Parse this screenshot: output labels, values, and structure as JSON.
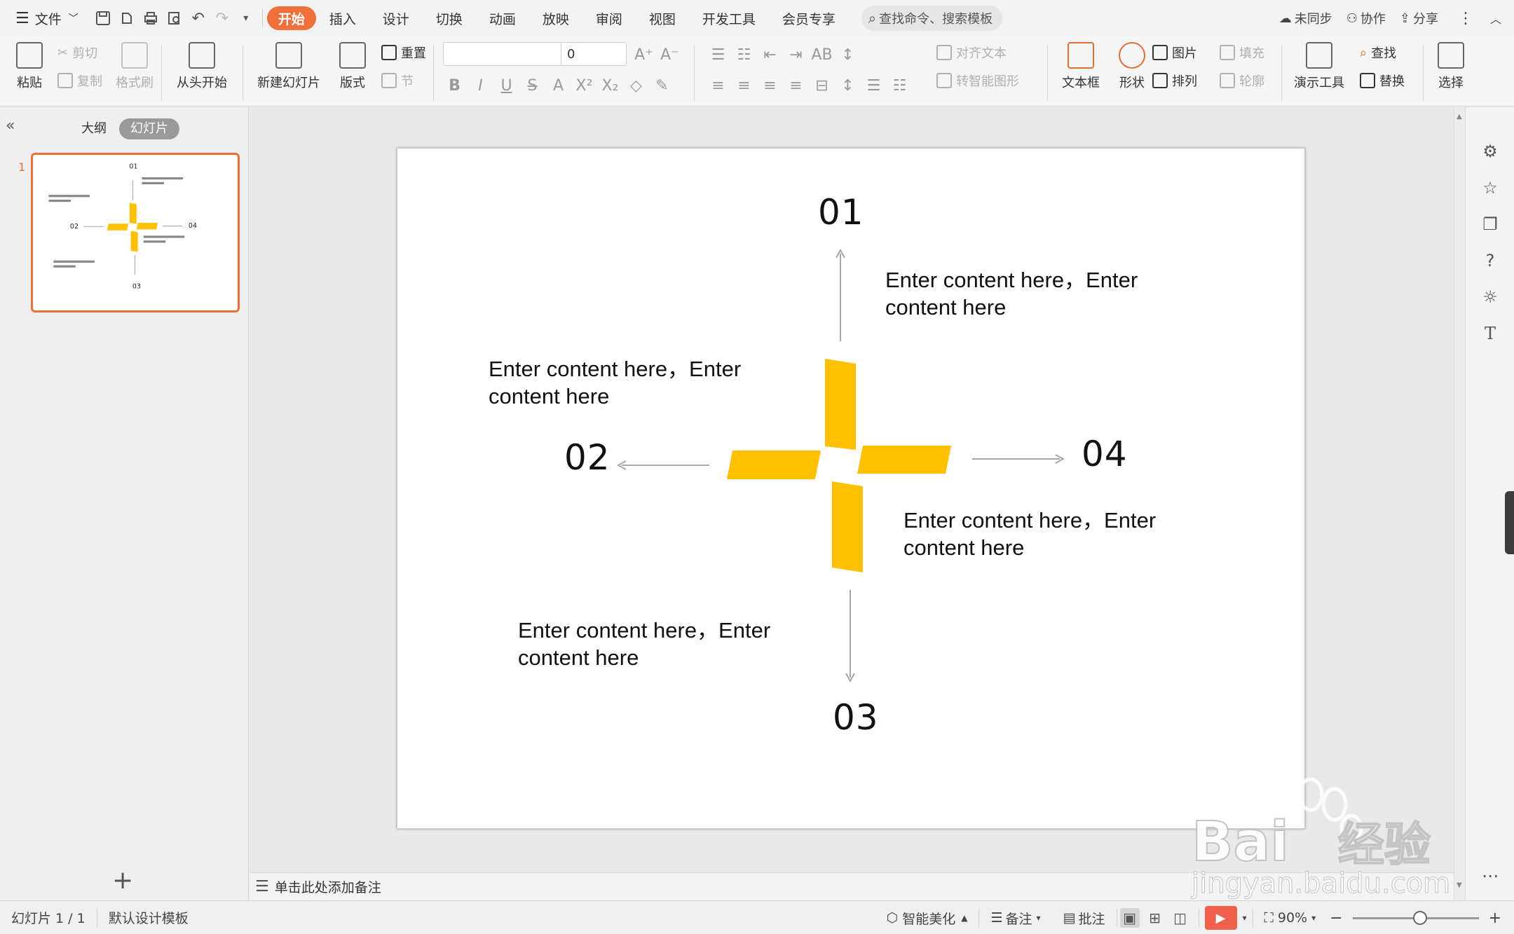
{
  "menubar": {
    "file_label": "文件",
    "tabs": [
      "开始",
      "插入",
      "设计",
      "切换",
      "动画",
      "放映",
      "审阅",
      "视图",
      "开发工具",
      "会员专享"
    ],
    "active_tab": "开始",
    "search_placeholder": "查找命令、搜索模板",
    "sync_label": "未同步",
    "collab_label": "协作",
    "share_label": "分享"
  },
  "ribbon": {
    "paste": "粘贴",
    "cut": "剪切",
    "copy": "复制",
    "format_painter": "格式刷",
    "from_start": "从头开始",
    "new_slide": "新建幻灯片",
    "layout": "版式",
    "reset": "重置",
    "section": "节",
    "font_size": "0",
    "align_text": "对齐文本",
    "smart_shape": "转智能图形",
    "textbox": "文本框",
    "shape": "形状",
    "picture": "图片",
    "fill": "填充",
    "arrange": "排列",
    "outline": "轮廓",
    "present_tools": "演示工具",
    "find": "查找",
    "replace": "替换",
    "select": "选择"
  },
  "leftpanel": {
    "outline_tab": "大纲",
    "slides_tab": "幻灯片",
    "thumb_number": "1"
  },
  "slide": {
    "items": [
      {
        "num": "01",
        "text": "Enter content here，Enter content here"
      },
      {
        "num": "02",
        "text": "Enter content here，Enter content here"
      },
      {
        "num": "03",
        "text": "Enter content here，Enter content here"
      },
      {
        "num": "04",
        "text": "Enter content here，Enter content here"
      }
    ],
    "accent_color": "#FFC000",
    "arrow_color": "#A6A6A6"
  },
  "notes": {
    "placeholder": "单击此处添加备注"
  },
  "statusbar": {
    "slide_info": "幻灯片 1 / 1",
    "template": "默认设计模板",
    "smart_beautify": "智能美化",
    "notes": "备注",
    "comments": "批注",
    "zoom": "90%"
  },
  "watermark": {
    "brand": "Bai",
    "site": "jingyan.baidu.com",
    "label": "经验"
  }
}
